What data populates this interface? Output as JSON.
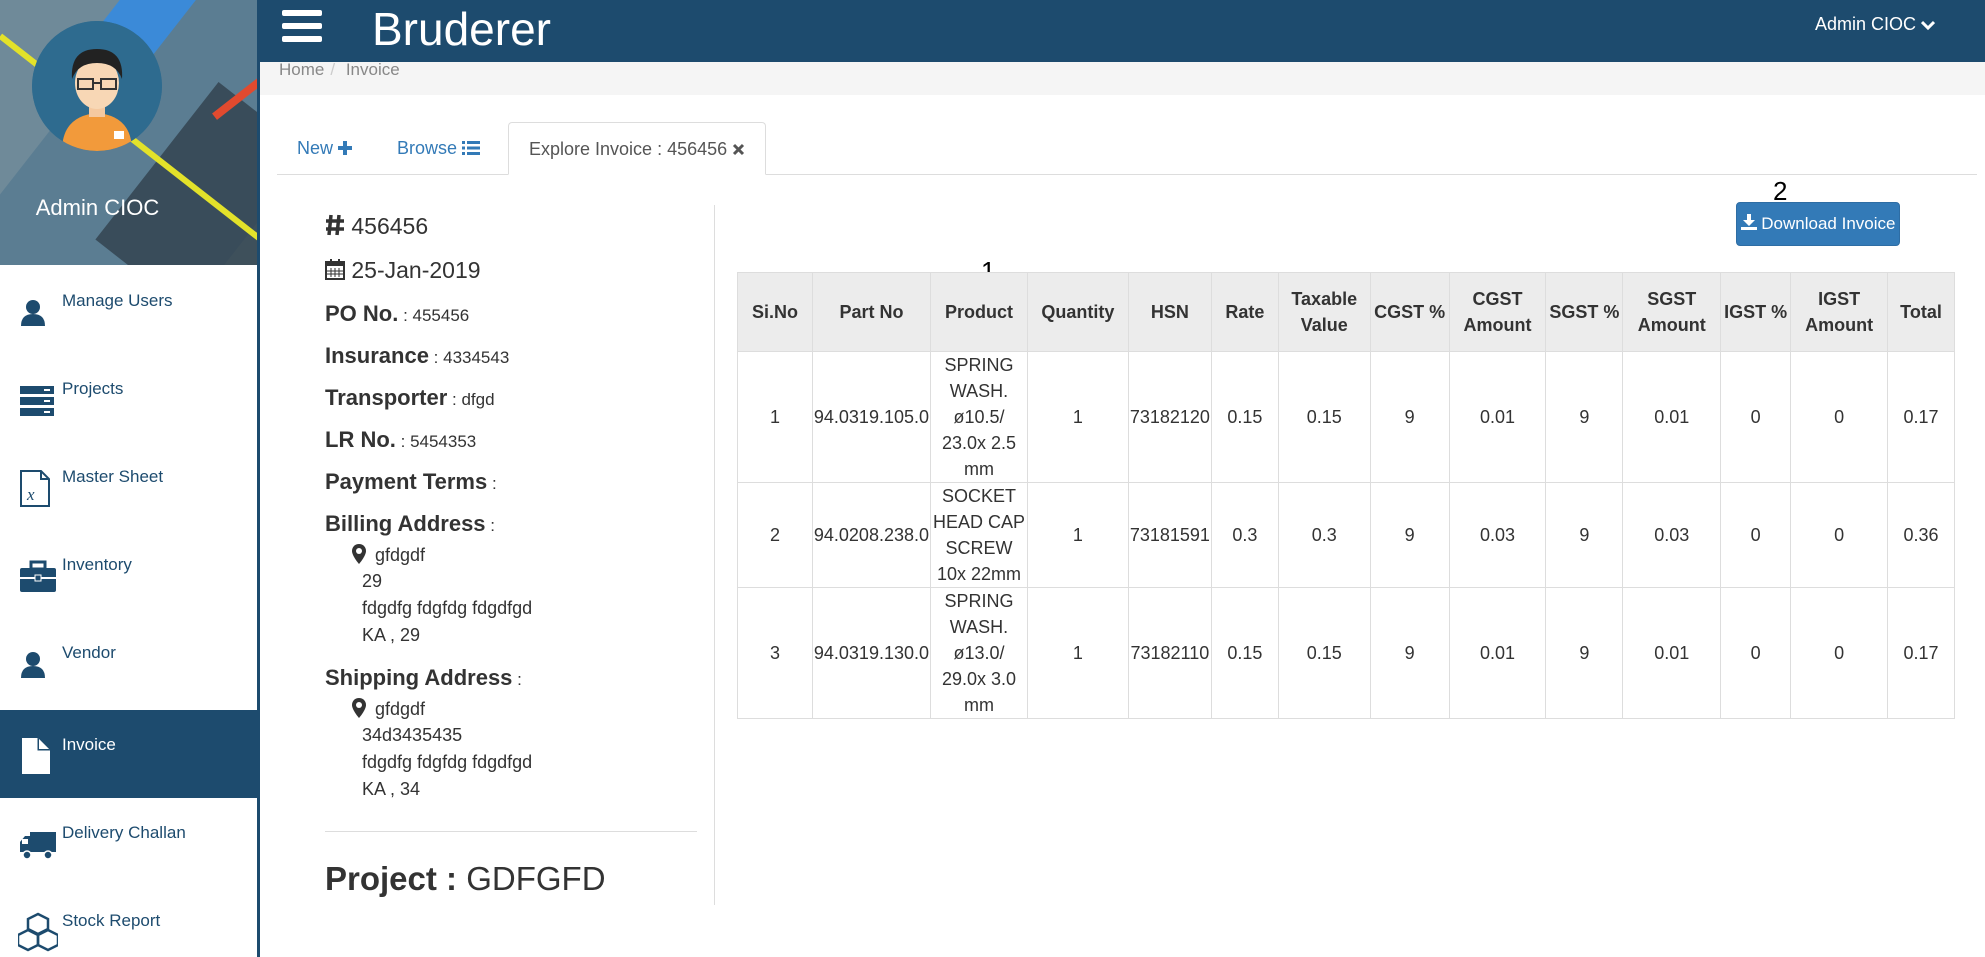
{
  "profile": {
    "name": "Admin CIOC"
  },
  "nav": [
    {
      "label": "Manage Users",
      "icon": "user-icon"
    },
    {
      "label": "Projects",
      "icon": "server-icon"
    },
    {
      "label": "Master Sheet",
      "icon": "excel-file-icon"
    },
    {
      "label": "Inventory",
      "icon": "briefcase-icon"
    },
    {
      "label": "Vendor",
      "icon": "user-icon"
    },
    {
      "label": "Invoice",
      "icon": "file-icon"
    },
    {
      "label": "Delivery Challan",
      "icon": "truck-icon"
    },
    {
      "label": "Stock Report",
      "icon": "cubes-icon"
    }
  ],
  "header": {
    "brand": "Bruderer",
    "user": "Admin CIOC"
  },
  "breadcrumb": {
    "home": "Home",
    "current": "Invoice"
  },
  "tabs": {
    "new": "New",
    "browse": "Browse",
    "explore": "Explore Invoice : 456456"
  },
  "invoice": {
    "number": "456456",
    "date": "25-Jan-2019",
    "po_label": "PO No.",
    "po_value": ": 455456",
    "insurance_label": "Insurance",
    "insurance_value": ": 4334543",
    "transporter_label": "Transporter",
    "transporter_value": ": dfgd",
    "lr_label": "LR No.",
    "lr_value": ": 5454353",
    "payment_label": "Payment Terms",
    "payment_value": ":",
    "billing_label": "Billing Address",
    "billing_colon": ":",
    "billing": [
      "gfdgdf",
      "29",
      "fdgdfg fdgfdg fdgdfgd",
      "KA , 29"
    ],
    "shipping_label": "Shipping Address",
    "shipping_colon": ":",
    "shipping": [
      "gfdgdf",
      "34d3435435",
      "fdgdfg fdgfdg fdgdfgd",
      "KA , 34"
    ],
    "project_label": "Project :",
    "project_value": "GDFGFD"
  },
  "download_label": "Download Invoice",
  "markers": {
    "one": "1",
    "two": "2"
  },
  "table": {
    "headers": [
      "Si.No",
      "Part No",
      "Product",
      "Quantity",
      "HSN",
      "Rate",
      "Taxable Value",
      "CGST %",
      "CGST Amount",
      "SGST %",
      "SGST Amount",
      "IGST %",
      "IGST Amount",
      "Total"
    ],
    "rows": [
      [
        "1",
        "94.0319.105.0",
        "SPRING WASH. ø10.5/ 23.0x 2.5 mm",
        "1",
        "73182120",
        "0.15",
        "0.15",
        "9",
        "0.01",
        "9",
        "0.01",
        "0",
        "0",
        "0.17"
      ],
      [
        "2",
        "94.0208.238.0",
        "SOCKET HEAD CAP SCREW 10x 22mm",
        "1",
        "73181591",
        "0.3",
        "0.3",
        "9",
        "0.03",
        "9",
        "0.03",
        "0",
        "0",
        "0.36"
      ],
      [
        "3",
        "94.0319.130.0",
        "SPRING WASH. ø13.0/ 29.0x 3.0 mm",
        "1",
        "73182110",
        "0.15",
        "0.15",
        "9",
        "0.01",
        "9",
        "0.01",
        "0",
        "0",
        "0.17"
      ]
    ]
  },
  "colors": {
    "primary": "#1d4b6e",
    "button": "#337ab7"
  }
}
